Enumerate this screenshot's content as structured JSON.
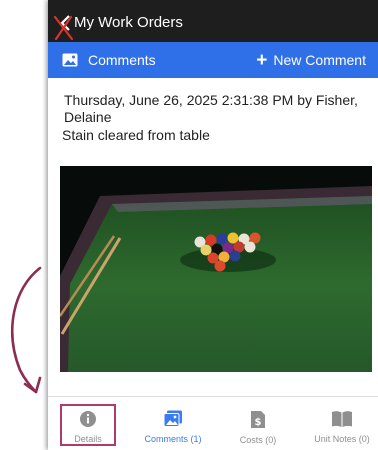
{
  "header": {
    "title": "My Work Orders"
  },
  "subbar": {
    "comments_label": "Comments",
    "new_comment_label": "New Comment"
  },
  "comment": {
    "meta": "Thursday, June 26, 2025 2:31:38 PM by Fisher, Delaine",
    "text": "Stain cleared from table"
  },
  "tabs": [
    {
      "label": "Details",
      "icon": "info-icon"
    },
    {
      "label": "Comments (1)",
      "icon": "image-icon"
    },
    {
      "label": "Costs (0)",
      "icon": "dollar-doc-icon"
    },
    {
      "label": "Unit Notes (0)",
      "icon": "book-icon"
    }
  ],
  "colors": {
    "header_bg": "#1e1e1e",
    "subbar_bg": "#2f6fe8",
    "active_tab": "#3a7bf0",
    "annotation": "#b03a6a"
  }
}
